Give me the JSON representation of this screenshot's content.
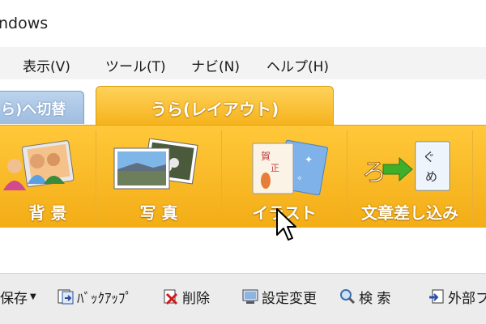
{
  "window": {
    "title": "ndows"
  },
  "menu": [
    {
      "label": "表示(V)"
    },
    {
      "label": "ツール(T)"
    },
    {
      "label": "ナビ(N)"
    },
    {
      "label": "ヘルプ(H)"
    }
  ],
  "tabs": {
    "left": "ら)へ切替",
    "active": "うら(レイアウト)"
  },
  "ribbon": [
    {
      "label": "背 景",
      "icon": "background-photo-icon"
    },
    {
      "label": "写 真",
      "icon": "photos-icon"
    },
    {
      "label": "イラスト",
      "icon": "illustration-icon"
    },
    {
      "label": "文章差し込み",
      "icon": "text-insert-icon"
    }
  ],
  "toolbar": [
    {
      "label": "保存",
      "icon": ""
    },
    {
      "label": "ﾊﾞｯｸｱｯﾌﾟ",
      "icon": "backup-icon"
    },
    {
      "label": "削除",
      "icon": "delete-icon"
    },
    {
      "label": "設定変更",
      "icon": "settings-change-icon"
    },
    {
      "label": "検 索",
      "icon": "search-icon"
    },
    {
      "label": "外部フ",
      "icon": "external-icon"
    }
  ],
  "colors": {
    "ribbon": "#f5b21c",
    "tab_inactive": "#9ebde0"
  }
}
